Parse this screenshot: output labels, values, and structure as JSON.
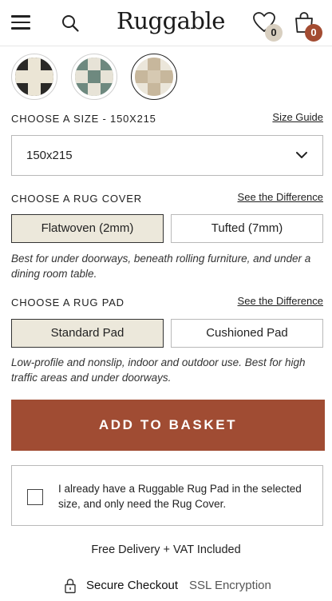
{
  "header": {
    "logo": "Ruggable",
    "wishlist_count": "0",
    "cart_count": "0",
    "icons": [
      "menu-icon",
      "search-icon",
      "heart-icon",
      "bag-icon"
    ]
  },
  "swatches": {
    "colors": [
      "#2b2a28 / #e9e3d3",
      "#6f8a80 / #e6e2d6",
      "#c8b89d / #ebe6da"
    ]
  },
  "size": {
    "label": "CHOOSE A SIZE - 150X215",
    "guide_link": "Size Guide",
    "selected": "150x215"
  },
  "cover": {
    "label": "CHOOSE A RUG COVER",
    "link": "See the Difference",
    "options": [
      "Flatwoven (2mm)",
      "Tufted (7mm)"
    ],
    "selected_index": 0,
    "description": "Best for under doorways, beneath rolling furniture, and under a dining room table."
  },
  "pad": {
    "label": "CHOOSE A RUG PAD",
    "link": "See the Difference",
    "options": [
      "Standard Pad",
      "Cushioned Pad"
    ],
    "selected_index": 0,
    "description": "Low-profile and nonslip, indoor and outdoor use. Best for high traffic areas and under doorways."
  },
  "actions": {
    "add_to_basket": "ADD TO BASKET"
  },
  "pad_only": {
    "text": "I already have a Ruggable Rug Pad in the selected size, and only need the Rug Cover.",
    "checked": false
  },
  "footer": {
    "delivery": "Free Delivery + VAT Included",
    "secure_bold": "Secure Checkout",
    "secure_light": "SSL Encryption"
  },
  "colors": {
    "accent": "#a04c33",
    "selected_bg": "#ece8db"
  }
}
